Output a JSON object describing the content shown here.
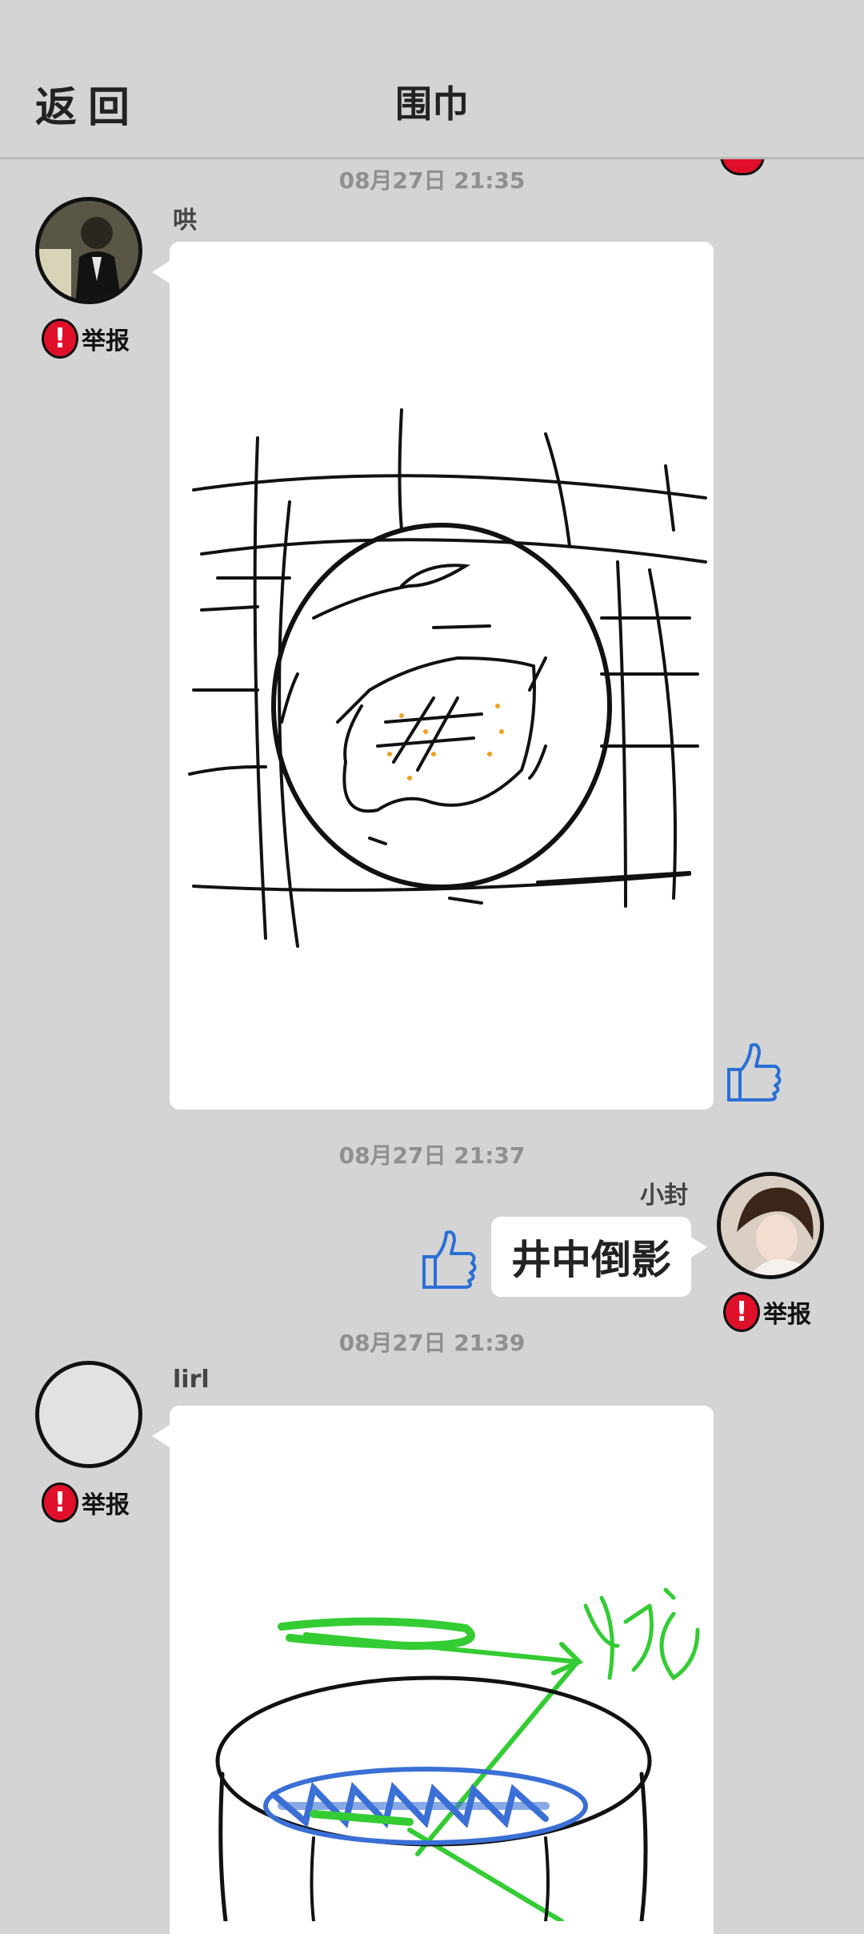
{
  "header": {
    "back_label": "返回",
    "title": "围巾"
  },
  "messages": [
    {
      "time": "08月27日  21:35",
      "sender": "哄",
      "side": "left",
      "type": "drawing",
      "report_label": "举报"
    },
    {
      "time": "08月27日  21:37",
      "sender": "小封",
      "side": "right",
      "type": "text",
      "text": "井中倒影",
      "report_label": "举报"
    },
    {
      "time": "08月27日  21:39",
      "sender": "lirl",
      "side": "left",
      "type": "drawing",
      "report_label": "举报"
    }
  ],
  "colors": {
    "background": "#d4d4d4",
    "bubble": "#ffffff",
    "report": "#e0102a",
    "like": "#2a6fd6"
  },
  "icons": [
    "report-icon",
    "thumbs-up-icon",
    "avatar"
  ]
}
